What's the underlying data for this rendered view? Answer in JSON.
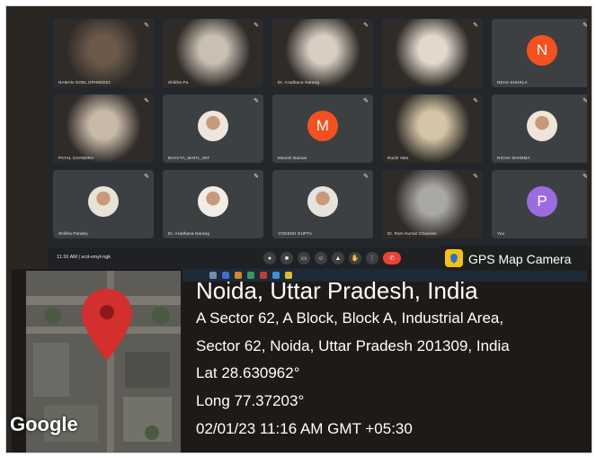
{
  "meeting": {
    "tiles": [
      {
        "name": "NAMAN GOEL DPHM2021",
        "kind": "photo",
        "tone": "#6b5a4a"
      },
      {
        "name": "Shikha Pa",
        "kind": "photo",
        "tone": "#c9c0b2"
      },
      {
        "name": "Dr. Aradhana Narang",
        "kind": "photo",
        "tone": "#d8cfc2"
      },
      {
        "name": "",
        "kind": "photo",
        "tone": "#e2d8cc"
      },
      {
        "name": "NEHA SHUKLA",
        "kind": "avatar",
        "letter": "N",
        "color": "#f4511e"
      },
      {
        "name": "PAYAL CHANDRA",
        "kind": "photo",
        "tone": "#c8b9a8"
      },
      {
        "name": "BHAVYA_MATH_JNT",
        "kind": "face",
        "color": "#ece6de"
      },
      {
        "name": "Manish Bansal",
        "kind": "avatar",
        "letter": "M",
        "color": "#f4511e"
      },
      {
        "name": "Ruchi Vats",
        "kind": "photo",
        "tone": "#d3c5a5"
      },
      {
        "name": "RICHA SHARMA",
        "kind": "face",
        "color": "#efe4d8"
      },
      {
        "name": "Shikha Pandey",
        "kind": "face",
        "color": "#e9e2d6"
      },
      {
        "name": "Dr. Aradhana Narang",
        "kind": "face",
        "color": "#f1ece6"
      },
      {
        "name": "YOGESH GUPTA",
        "kind": "face",
        "color": "#e6e3dd"
      },
      {
        "name": "Dr. Ram Kumar Chauhan",
        "kind": "photo",
        "tone": "#a9a8a4"
      },
      {
        "name": "You",
        "kind": "avatar",
        "letter": "P",
        "color": "#9c6be0"
      }
    ],
    "time_label": "11:16 AM | scd-vmyt-ngk"
  },
  "gps": {
    "app_label": "GPS Map Camera",
    "place": "Noida, Uttar Pradesh, India",
    "address_line1": "A Sector 62, A Block, Block A, Industrial Area,",
    "address_line2": "Sector 62, Noida, Uttar Pradesh 201309, India",
    "lat": "Lat 28.630962°",
    "long": "Long 77.37203°",
    "datetime": "02/01/23 11:16 AM GMT +05:30",
    "map_brand": "Google",
    "pin_color": "#d32f2f"
  }
}
